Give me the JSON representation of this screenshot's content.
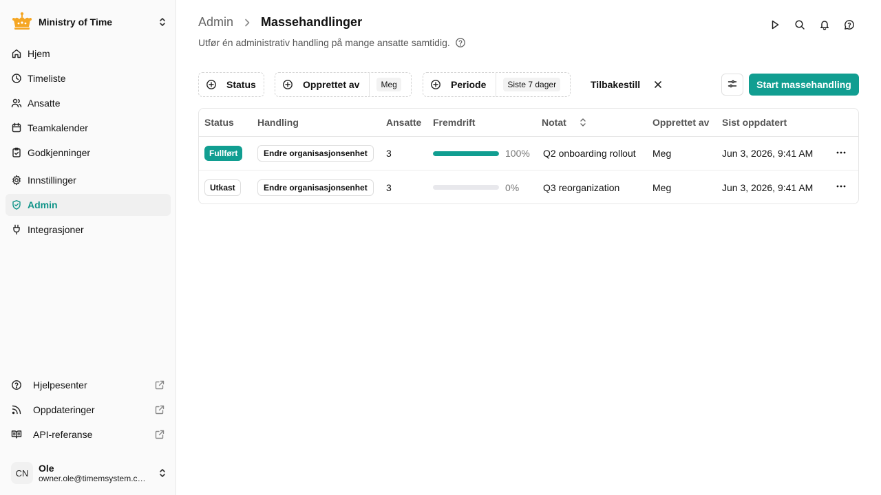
{
  "org": {
    "name": "Ministry of Time"
  },
  "nav": [
    {
      "label": "Hjem",
      "icon": "home-icon"
    },
    {
      "label": "Timeliste",
      "icon": "clock-icon"
    },
    {
      "label": "Ansatte",
      "icon": "users-icon"
    },
    {
      "label": "Teamkalender",
      "icon": "calendar-icon"
    },
    {
      "label": "Godkjenninger",
      "icon": "clipboard-check-icon"
    },
    {
      "label": "Innstillinger",
      "icon": "gear-icon"
    },
    {
      "label": "Admin",
      "icon": "shield-check-icon",
      "active": true
    },
    {
      "label": "Integrasjoner",
      "icon": "plug-icon"
    }
  ],
  "bottom_nav": [
    {
      "label": "Hjelpesenter",
      "icon": "help-circle-icon"
    },
    {
      "label": "Oppdateringer",
      "icon": "rss-icon"
    },
    {
      "label": "API-referanse",
      "icon": "book-icon"
    }
  ],
  "user": {
    "initials": "CN",
    "name": "Ole",
    "email": "owner.ole@timemsystem.com"
  },
  "breadcrumb": {
    "parent": "Admin",
    "current": "Massehandlinger"
  },
  "subtitle": "Utfør én administrativ handling på mange ansatte samtidig.",
  "filters": {
    "status": "Status",
    "created_by": "Opprettet av",
    "created_by_value": "Meg",
    "period": "Periode",
    "period_value": "Siste 7 dager",
    "reset": "Tilbakestill"
  },
  "primary_button": "Start massehandling",
  "table": {
    "headers": [
      "Status",
      "Handling",
      "Ansatte",
      "Fremdrift",
      "Notat",
      "Opprettet av",
      "Sist oppdatert"
    ],
    "rows": [
      {
        "status": "Fullført",
        "action": "Endre organisasjonsenhet",
        "employees": "3",
        "progress": 1.0,
        "progress_label": "100%",
        "note": "Q2 onboarding rollout",
        "created_by": "Meg",
        "updated": "Jun 3, 2026, 9:41 AM"
      },
      {
        "status": "Utkast",
        "action": "Endre organisasjonsenhet",
        "employees": "3",
        "progress": 0.0,
        "progress_label": "0%",
        "note": "Q3 reorganization",
        "created_by": "Meg",
        "updated": "Jun 3, 2026, 9:41 AM"
      }
    ]
  },
  "colors": {
    "accent": "#119e91",
    "logo": "#f5a623"
  }
}
